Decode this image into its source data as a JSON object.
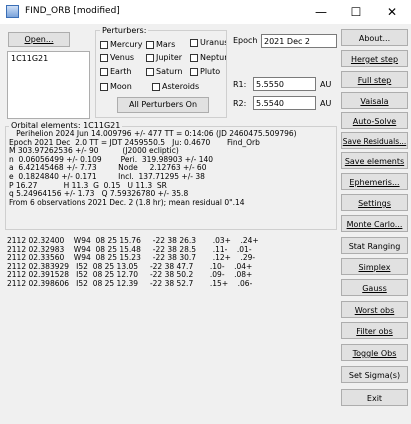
{
  "window": {
    "title": "FIND_ORB [modified]",
    "min_glyph": "—",
    "max_glyph": "☐",
    "close_glyph": "✕"
  },
  "open_button": {
    "label": "Open..."
  },
  "object_list": [
    "1C11G21"
  ],
  "perturbers": {
    "legend": "Perturbers:",
    "items": [
      "Mercury",
      "Mars",
      "Uranus",
      "Venus",
      "Jupiter",
      "Neptune",
      "Earth",
      "Saturn",
      "Pluto",
      "Moon",
      "Asteroids"
    ],
    "all_button": "All Perturbers On"
  },
  "epoch": {
    "label": "Epoch",
    "value": "2021 Dec  2"
  },
  "r1": {
    "label": "R1:",
    "value": "5.5550",
    "unit": "AU"
  },
  "r2": {
    "label": "R2:",
    "value": "5.5540",
    "unit": "AU"
  },
  "orbit": {
    "header": "Orbital elements:  1C11G21",
    "lines": [
      "   Perihelion 2024 Jun 14.009796 +/- 477 TT = 0:14:06 (JD 2460475.509796)",
      "Epoch 2021 Dec  2.0 TT = JDT 2459550.5   Ju: 0.4670       Find_Orb",
      "M 303.97262536 +/- 90          (J2000 ecliptic)",
      "n  0.06056499 +/- 0.109        Peri.  319.98903 +/- 140",
      "a  6.42145468 +/- 7.73         Node     2.12763 +/- 60",
      "e  0.1824840 +/- 0.171         Incl.  137.71295 +/- 38",
      "P 16.27           H 11.3  G  0.15   U 11.3  SR",
      "q 5.24964156 +/- 1.73   Q 7.59326780 +/- 35.8",
      "From 6 observations 2021 Dec. 2 (1.8 hr); mean residual 0\".14"
    ]
  },
  "observations": [
    "2112 02.32400    W94  08 25 15.76     -22 38 26.3       .03+    .24+",
    "2112 02.32983    W94  08 25 15.48     -22 38 28.5       .11-    .01-",
    "2112 02.33560    W94  08 25 15.23     -22 38 30.7       .12+    .29-",
    "2112 02.383929   I52  08 25 13.05     -22 38 47.7       .10-    .04+",
    "2112 02.391528   I52  08 25 12.70     -22 38 50.2       .09-    .08+",
    "2112 02.398606   I52  08 25 12.39     -22 38 52.7       .15+    .06-"
  ],
  "side_buttons": [
    "About...",
    "Herget step",
    "Full step",
    "Vaisala",
    "Auto-Solve",
    "Save Residuals...",
    "Save elements",
    "Ephemeris...",
    "Settings",
    "Monte Carlo...",
    "Stat Ranging",
    "Simplex",
    "Gauss",
    "Worst obs",
    "Filter obs",
    "Toggle Obs",
    "Set Sigma(s)",
    "Exit"
  ]
}
